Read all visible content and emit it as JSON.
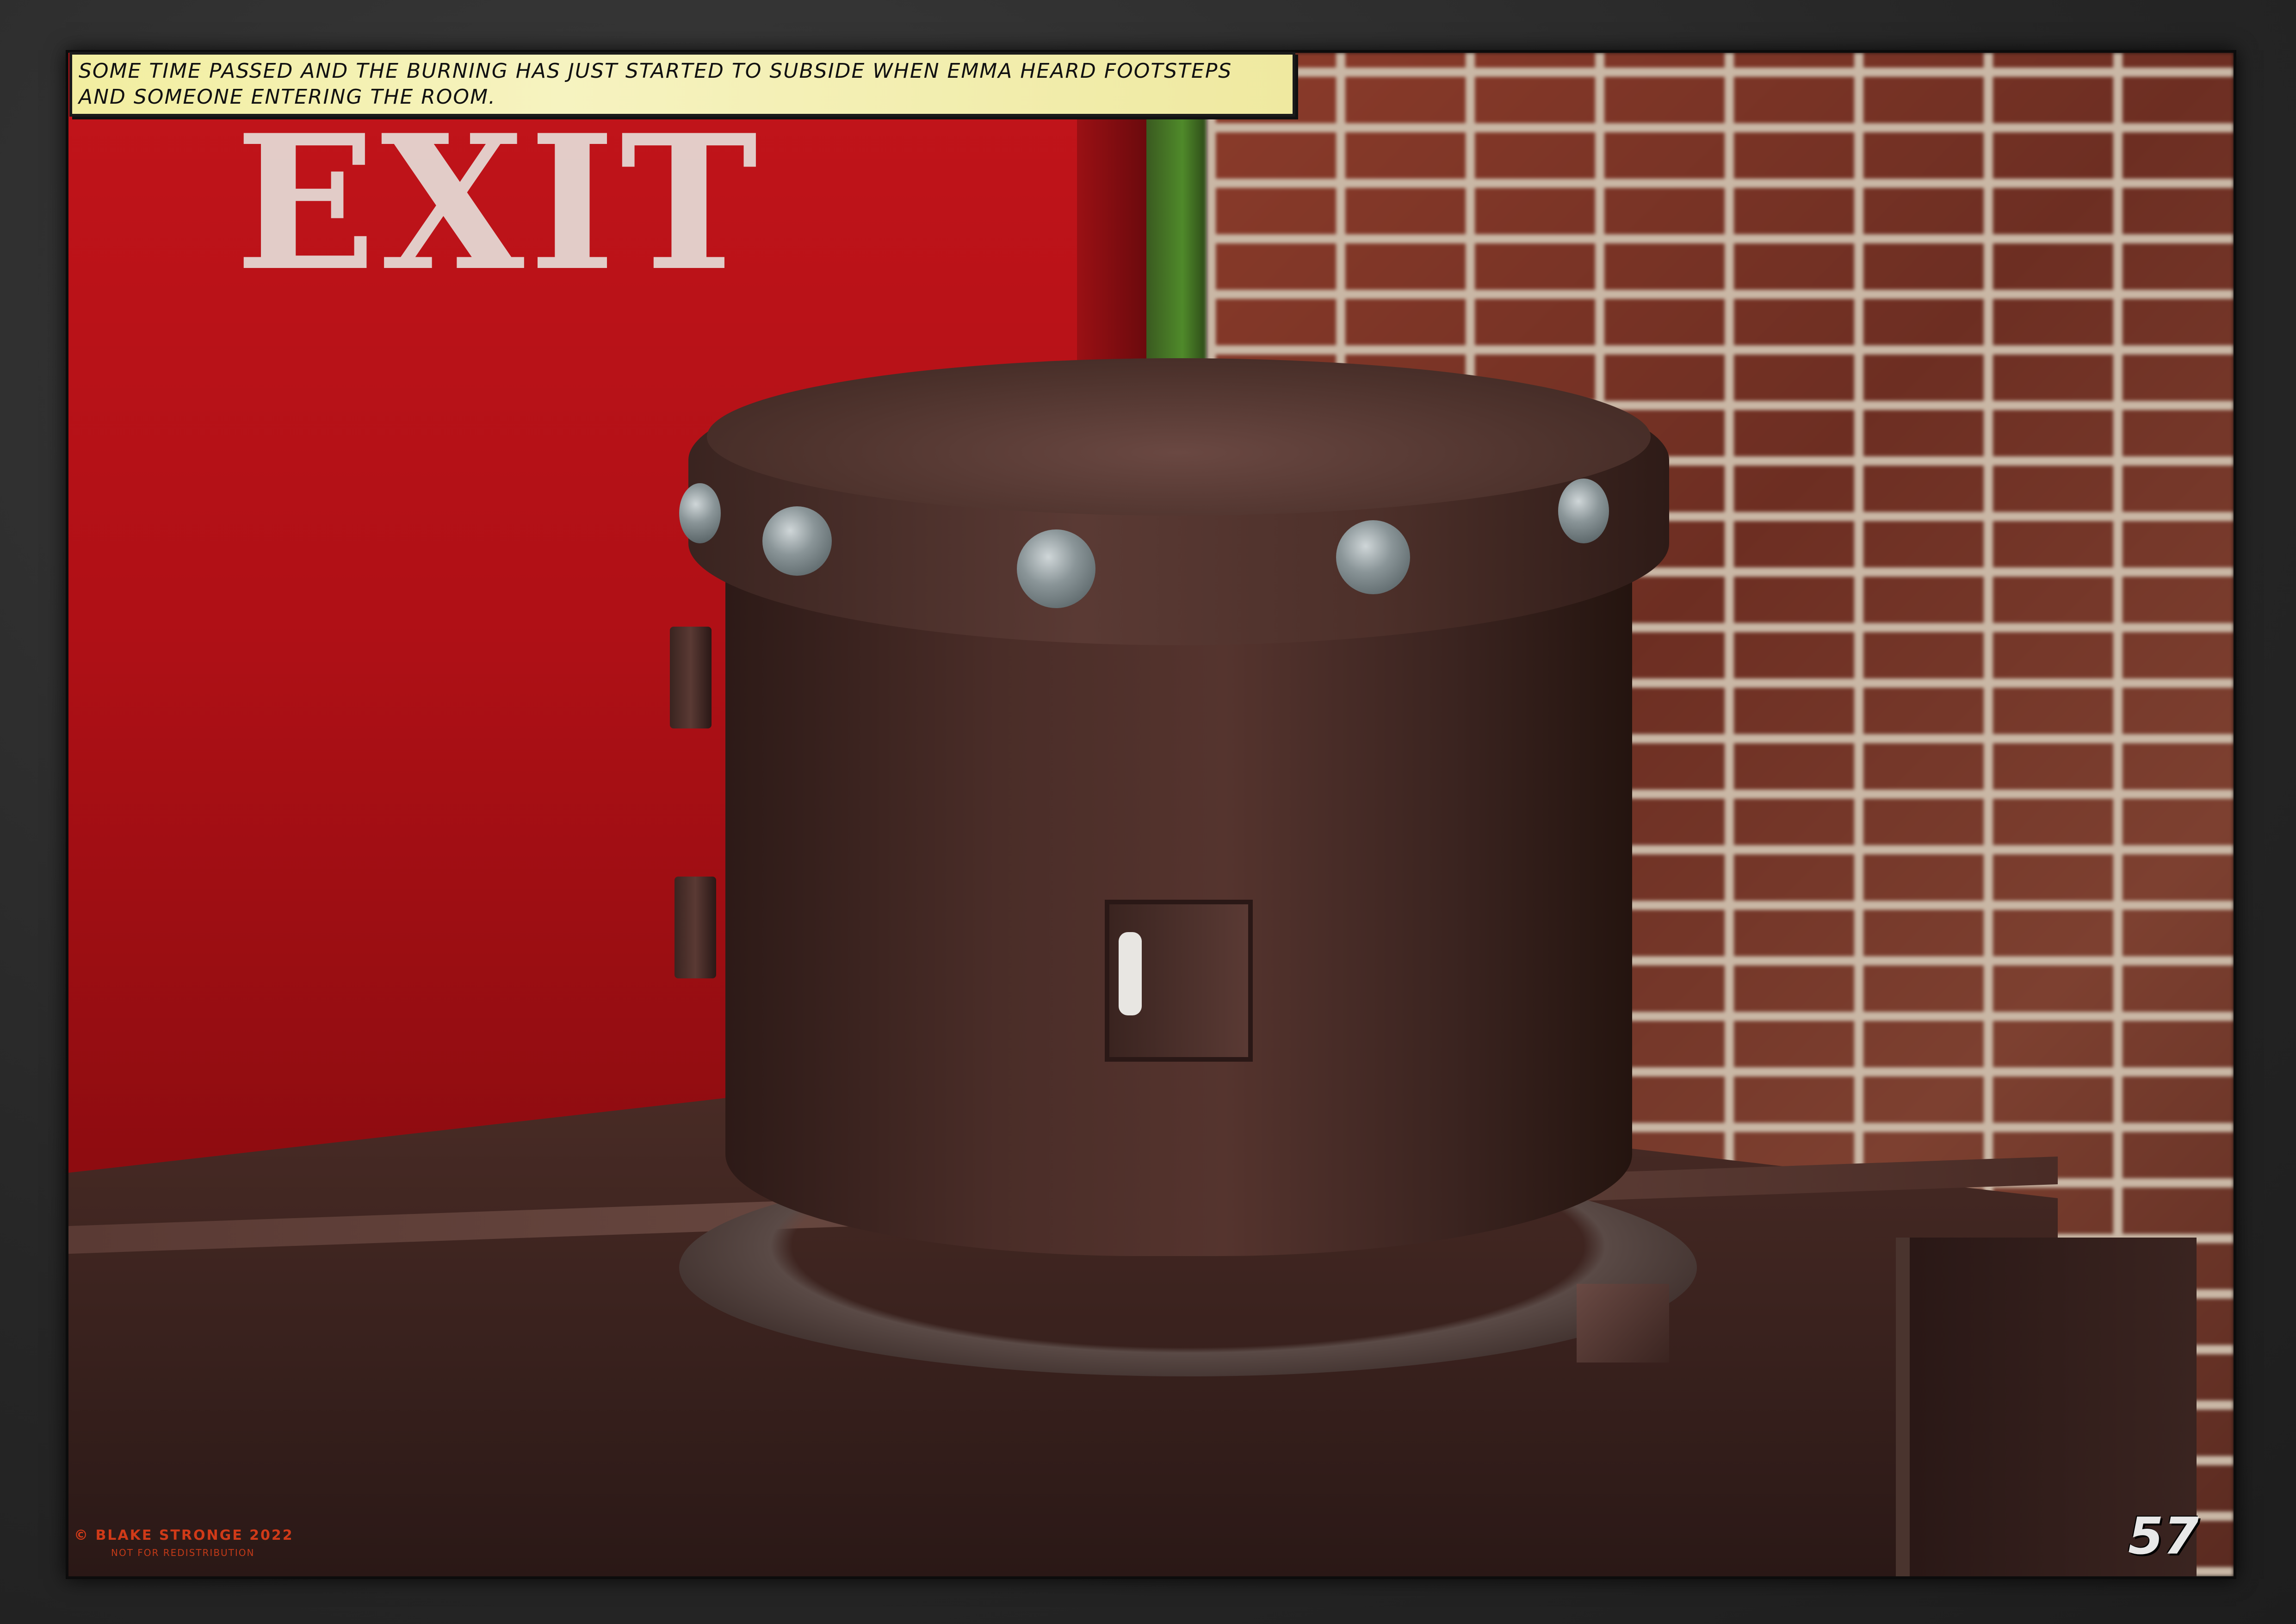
{
  "caption": {
    "line1": "Some time passed and the burning has just started to subside when Emma heard footsteps",
    "line2": "and someone entering the room."
  },
  "scene": {
    "sign_text": "EXIT"
  },
  "footer": {
    "copyright": "© Blake Stronge 2022",
    "notice": "Not for redistribution",
    "page_number": "57"
  }
}
